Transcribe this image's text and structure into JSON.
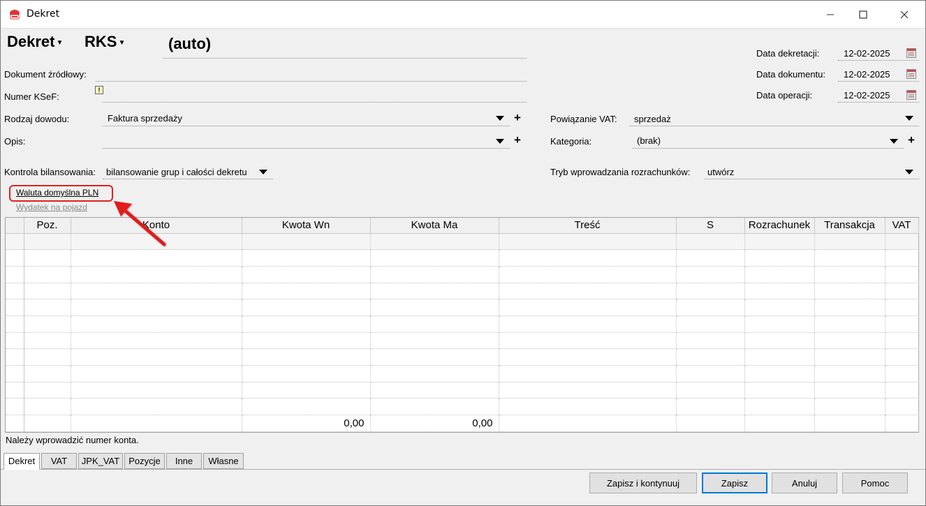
{
  "window": {
    "title": "Dekret"
  },
  "header": {
    "type_label": "Dekret",
    "register_label": "RKS",
    "number": "(auto)"
  },
  "fields": {
    "dokument_zrodlowy_label": "Dokument źródłowy:",
    "dokument_zrodlowy_value": "",
    "numer_ksef_label": "Numer KSeF:",
    "numer_ksef_badge": "!",
    "rodzaj_dowodu_label": "Rodzaj dowodu:",
    "rodzaj_dowodu_value": "Faktura sprzedaży",
    "opis_label": "Opis:",
    "opis_value": "",
    "kontrola_label": "Kontrola bilansowania:",
    "kontrola_value": "bilansowanie grup i całości dekretu",
    "powiazanie_vat_label": "Powiązanie VAT:",
    "powiazanie_vat_value": "sprzedaż",
    "kategoria_label": "Kategoria:",
    "kategoria_value": "(brak)",
    "tryb_label": "Tryb wprowadzania rozrachunków:",
    "tryb_value": "utwórz",
    "plus_symbol": "+"
  },
  "dates": {
    "data_dekretacji_label": "Data dekretacji:",
    "data_dekretacji_value": "12-02-2025",
    "data_dokumentu_label": "Data dokumentu:",
    "data_dokumentu_value": "12-02-2025",
    "data_operacji_label": "Data operacji:",
    "data_operacji_value": "12-02-2025"
  },
  "links": {
    "waluta": "Waluta domyślna PLN",
    "wydatek": "Wydatek na pojazd"
  },
  "table": {
    "columns": [
      "",
      "Poz.",
      "Konto",
      "Kwota Wn",
      "Kwota Ma",
      "Treść",
      "S",
      "Rozrachunek",
      "Transakcja",
      "VAT"
    ],
    "totals": {
      "kwota_wn": "0,00",
      "kwota_ma": "0,00"
    }
  },
  "status": {
    "message": "Należy wprowadzić numer konta."
  },
  "tabs": [
    "Dekret",
    "VAT",
    "JPK_VAT",
    "Pozycje",
    "Inne",
    "Własne"
  ],
  "buttons": {
    "zapisz_kontynuuj": "Zapisz i kontynuuj",
    "zapisz": "Zapisz",
    "anuluj": "Anuluj",
    "pomoc": "Pomoc"
  },
  "colors": {
    "accent": "#0078d7",
    "highlight": "#e02020"
  }
}
